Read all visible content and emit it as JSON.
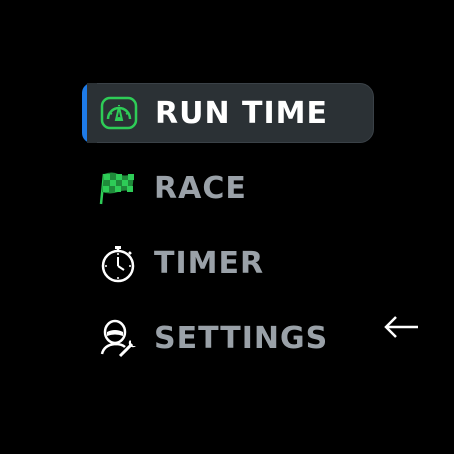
{
  "menu": {
    "items": [
      {
        "label": "RUN TIME",
        "icon": "speedometer-icon",
        "selected": true
      },
      {
        "label": "RACE",
        "icon": "checkered-flag-icon",
        "selected": false
      },
      {
        "label": "TIMER",
        "icon": "stopwatch-icon",
        "selected": false
      },
      {
        "label": "SETTINGS",
        "icon": "driver-wrench-icon",
        "selected": false
      }
    ]
  },
  "colors": {
    "background": "#000000",
    "selected_bg": "#2b3135",
    "accent": "#1e7be8",
    "icon_green": "#2ecc57",
    "label_inactive": "#9aa1a8",
    "label_active": "#ffffff"
  },
  "back": {
    "icon": "left-arrow-icon"
  }
}
